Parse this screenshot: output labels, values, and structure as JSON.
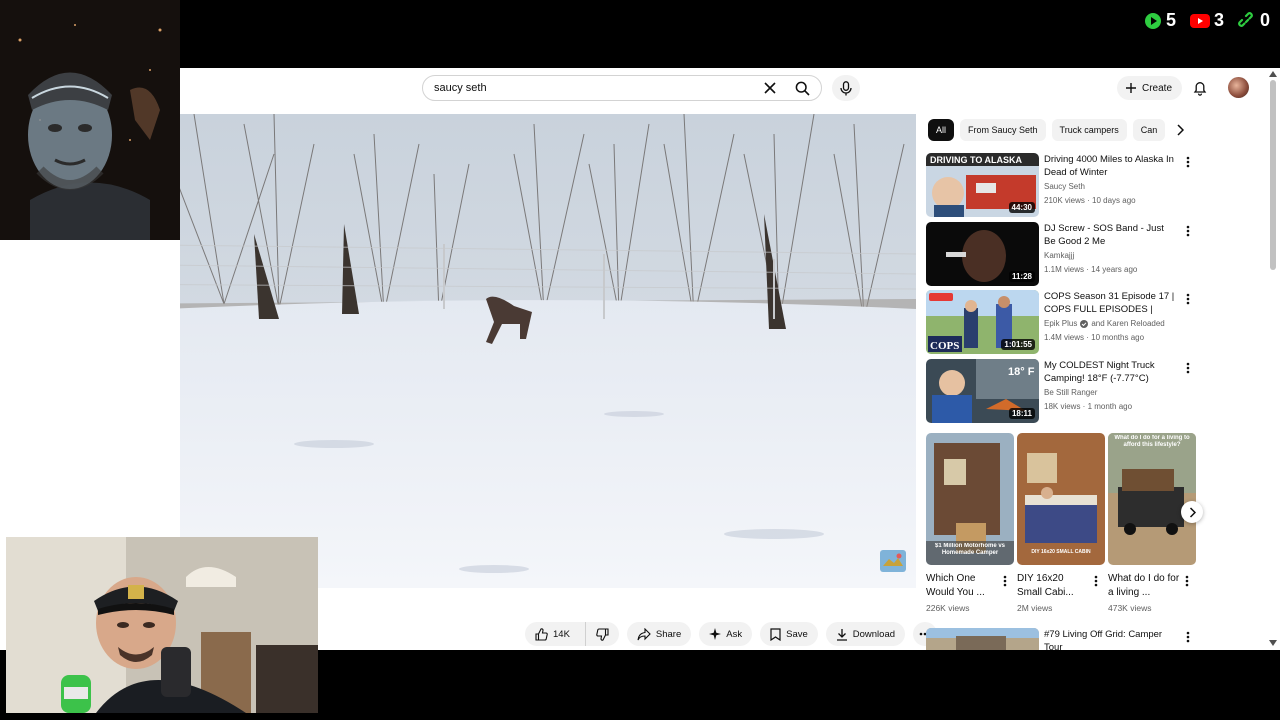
{
  "counters": [
    {
      "icon": "play-icon",
      "value": "5",
      "color": "#2ecc40"
    },
    {
      "icon": "youtube-icon",
      "value": "3",
      "color": "#ff0000"
    },
    {
      "icon": "link-icon",
      "value": "0",
      "color": "#2ecc40"
    }
  ],
  "header": {
    "search_value": "saucy seth",
    "create_label": "Create"
  },
  "actions": {
    "likes": "14K",
    "share": "Share",
    "ask": "Ask",
    "save": "Save",
    "download": "Download"
  },
  "chips": [
    "All",
    "From Saucy Seth",
    "Truck campers",
    "Can"
  ],
  "recommendations": [
    {
      "title": "Driving 4000 Miles to Alaska In Dead of Winter",
      "channel": "Saucy Seth",
      "verified": false,
      "meta": "210K views · 10 days ago",
      "duration": "44:30",
      "thumb_text": "DRIVING TO ALASKA"
    },
    {
      "title": "DJ Screw - SOS Band - Just Be Good 2 Me",
      "channel": "Kamkajjj",
      "verified": false,
      "meta": "1.1M views · 14 years ago",
      "duration": "11:28",
      "thumb_text": ""
    },
    {
      "title": "COPS Season 31 Episode 17 | COPS FULL EPISODES | Cops ...",
      "channel": "Epik Plus",
      "channel2": "and Karen Reloaded",
      "verified": true,
      "meta": "1.4M views · 10 months ago",
      "duration": "1:01:55",
      "thumb_text": "COPS"
    },
    {
      "title": "My COLDEST Night Truck Camping! 18°F (-7.77°C)",
      "channel": "Be Still Ranger",
      "verified": false,
      "meta": "18K views · 1 month ago",
      "duration": "18:11",
      "thumb_text": "18° F"
    },
    {
      "title": "#79 Living Off Grid: Camper Tour",
      "channel": "",
      "verified": false,
      "meta": "",
      "duration": "",
      "thumb_text": ""
    }
  ],
  "shorts": [
    {
      "title": "Which One Would You ...",
      "views": "226K views",
      "thumb_text": "$1 Million Motorhome vs Homemade Camper"
    },
    {
      "title": "DIY 16x20 Small Cabi...",
      "views": "2M views",
      "thumb_text": "DIY 16x20 SMALL CABIN"
    },
    {
      "title": "What do I do for a living ...",
      "views": "473K views",
      "thumb_text": "What do I do for a living to afford this lifestyle?"
    }
  ]
}
